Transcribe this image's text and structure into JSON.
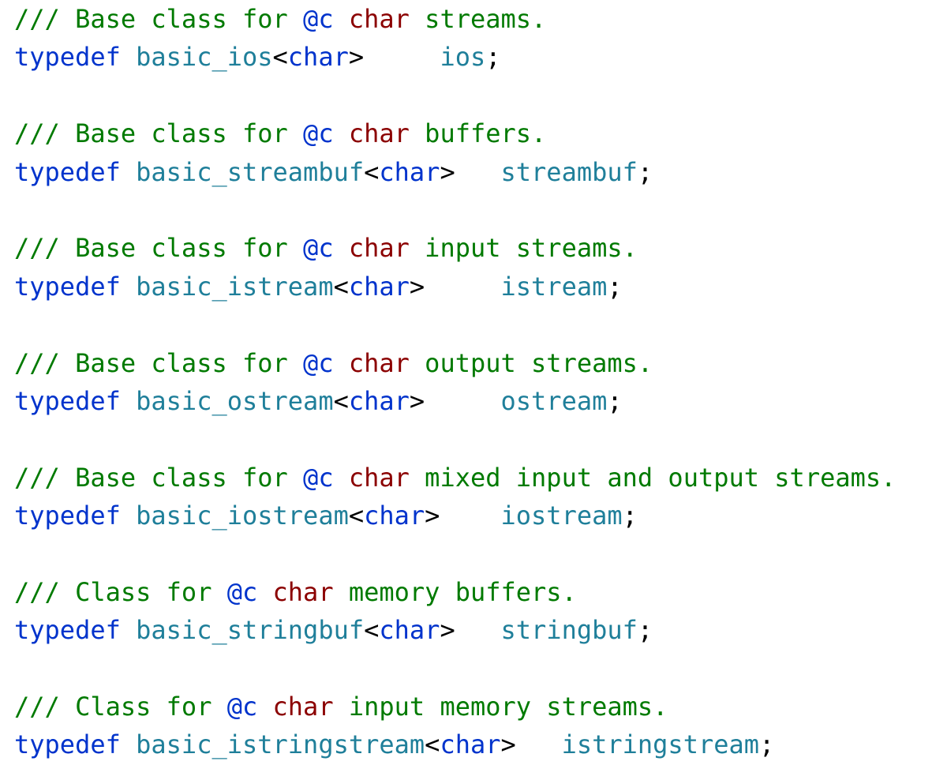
{
  "colors": {
    "comment": "#007a00",
    "keyword": "#0033cc",
    "type": "#1f7f9a",
    "doc_keyword": "#8b0000",
    "punctuation": "#000000",
    "angle_bracket": "#000000"
  },
  "lines": [
    {
      "kind": "code",
      "tokens": [
        {
          "t": "/// Base class for ",
          "c": "comment"
        },
        {
          "t": "@c",
          "c": "keyword"
        },
        {
          "t": " ",
          "c": "comment"
        },
        {
          "t": "char",
          "c": "doc_keyword"
        },
        {
          "t": " streams.",
          "c": "comment"
        }
      ]
    },
    {
      "kind": "code",
      "tokens": [
        {
          "t": "typedef",
          "c": "keyword"
        },
        {
          "t": " ",
          "c": "punctuation"
        },
        {
          "t": "basic_ios",
          "c": "type"
        },
        {
          "t": "<",
          "c": "angle_bracket"
        },
        {
          "t": "char",
          "c": "keyword"
        },
        {
          "t": ">",
          "c": "angle_bracket"
        },
        {
          "t": "     ",
          "c": "punctuation"
        },
        {
          "t": "ios",
          "c": "type"
        },
        {
          "t": ";",
          "c": "punctuation"
        }
      ]
    },
    {
      "kind": "blank"
    },
    {
      "kind": "code",
      "tokens": [
        {
          "t": "/// Base class for ",
          "c": "comment"
        },
        {
          "t": "@c",
          "c": "keyword"
        },
        {
          "t": " ",
          "c": "comment"
        },
        {
          "t": "char",
          "c": "doc_keyword"
        },
        {
          "t": " buffers.",
          "c": "comment"
        }
      ]
    },
    {
      "kind": "code",
      "tokens": [
        {
          "t": "typedef",
          "c": "keyword"
        },
        {
          "t": " ",
          "c": "punctuation"
        },
        {
          "t": "basic_streambuf",
          "c": "type"
        },
        {
          "t": "<",
          "c": "angle_bracket"
        },
        {
          "t": "char",
          "c": "keyword"
        },
        {
          "t": ">",
          "c": "angle_bracket"
        },
        {
          "t": "   ",
          "c": "punctuation"
        },
        {
          "t": "streambuf",
          "c": "type"
        },
        {
          "t": ";",
          "c": "punctuation"
        }
      ]
    },
    {
      "kind": "blank"
    },
    {
      "kind": "code",
      "tokens": [
        {
          "t": "/// Base class for ",
          "c": "comment"
        },
        {
          "t": "@c",
          "c": "keyword"
        },
        {
          "t": " ",
          "c": "comment"
        },
        {
          "t": "char",
          "c": "doc_keyword"
        },
        {
          "t": " input streams.",
          "c": "comment"
        }
      ]
    },
    {
      "kind": "code",
      "tokens": [
        {
          "t": "typedef",
          "c": "keyword"
        },
        {
          "t": " ",
          "c": "punctuation"
        },
        {
          "t": "basic_istream",
          "c": "type"
        },
        {
          "t": "<",
          "c": "angle_bracket"
        },
        {
          "t": "char",
          "c": "keyword"
        },
        {
          "t": ">",
          "c": "angle_bracket"
        },
        {
          "t": "     ",
          "c": "punctuation"
        },
        {
          "t": "istream",
          "c": "type"
        },
        {
          "t": ";",
          "c": "punctuation"
        }
      ]
    },
    {
      "kind": "blank"
    },
    {
      "kind": "code",
      "tokens": [
        {
          "t": "/// Base class for ",
          "c": "comment"
        },
        {
          "t": "@c",
          "c": "keyword"
        },
        {
          "t": " ",
          "c": "comment"
        },
        {
          "t": "char",
          "c": "doc_keyword"
        },
        {
          "t": " output streams.",
          "c": "comment"
        }
      ]
    },
    {
      "kind": "code",
      "tokens": [
        {
          "t": "typedef",
          "c": "keyword"
        },
        {
          "t": " ",
          "c": "punctuation"
        },
        {
          "t": "basic_ostream",
          "c": "type"
        },
        {
          "t": "<",
          "c": "angle_bracket"
        },
        {
          "t": "char",
          "c": "keyword"
        },
        {
          "t": ">",
          "c": "angle_bracket"
        },
        {
          "t": "     ",
          "c": "punctuation"
        },
        {
          "t": "ostream",
          "c": "type"
        },
        {
          "t": ";",
          "c": "punctuation"
        }
      ]
    },
    {
      "kind": "blank"
    },
    {
      "kind": "code",
      "tokens": [
        {
          "t": "/// Base class for ",
          "c": "comment"
        },
        {
          "t": "@c",
          "c": "keyword"
        },
        {
          "t": " ",
          "c": "comment"
        },
        {
          "t": "char",
          "c": "doc_keyword"
        },
        {
          "t": " mixed input and output streams.",
          "c": "comment"
        }
      ]
    },
    {
      "kind": "code",
      "tokens": [
        {
          "t": "typedef",
          "c": "keyword"
        },
        {
          "t": " ",
          "c": "punctuation"
        },
        {
          "t": "basic_iostream",
          "c": "type"
        },
        {
          "t": "<",
          "c": "angle_bracket"
        },
        {
          "t": "char",
          "c": "keyword"
        },
        {
          "t": ">",
          "c": "angle_bracket"
        },
        {
          "t": "    ",
          "c": "punctuation"
        },
        {
          "t": "iostream",
          "c": "type"
        },
        {
          "t": ";",
          "c": "punctuation"
        }
      ]
    },
    {
      "kind": "blank"
    },
    {
      "kind": "code",
      "tokens": [
        {
          "t": "/// Class for ",
          "c": "comment"
        },
        {
          "t": "@c",
          "c": "keyword"
        },
        {
          "t": " ",
          "c": "comment"
        },
        {
          "t": "char",
          "c": "doc_keyword"
        },
        {
          "t": " memory buffers.",
          "c": "comment"
        }
      ]
    },
    {
      "kind": "code",
      "tokens": [
        {
          "t": "typedef",
          "c": "keyword"
        },
        {
          "t": " ",
          "c": "punctuation"
        },
        {
          "t": "basic_stringbuf",
          "c": "type"
        },
        {
          "t": "<",
          "c": "angle_bracket"
        },
        {
          "t": "char",
          "c": "keyword"
        },
        {
          "t": ">",
          "c": "angle_bracket"
        },
        {
          "t": "   ",
          "c": "punctuation"
        },
        {
          "t": "stringbuf",
          "c": "type"
        },
        {
          "t": ";",
          "c": "punctuation"
        }
      ]
    },
    {
      "kind": "blank"
    },
    {
      "kind": "code",
      "tokens": [
        {
          "t": "/// Class for ",
          "c": "comment"
        },
        {
          "t": "@c",
          "c": "keyword"
        },
        {
          "t": " ",
          "c": "comment"
        },
        {
          "t": "char",
          "c": "doc_keyword"
        },
        {
          "t": " input memory streams.",
          "c": "comment"
        }
      ]
    },
    {
      "kind": "code",
      "tokens": [
        {
          "t": "typedef",
          "c": "keyword"
        },
        {
          "t": " ",
          "c": "punctuation"
        },
        {
          "t": "basic_istringstream",
          "c": "type"
        },
        {
          "t": "<",
          "c": "angle_bracket"
        },
        {
          "t": "char",
          "c": "keyword"
        },
        {
          "t": ">",
          "c": "angle_bracket"
        },
        {
          "t": "   ",
          "c": "punctuation"
        },
        {
          "t": "istringstream",
          "c": "type"
        },
        {
          "t": ";",
          "c": "punctuation"
        }
      ]
    }
  ]
}
